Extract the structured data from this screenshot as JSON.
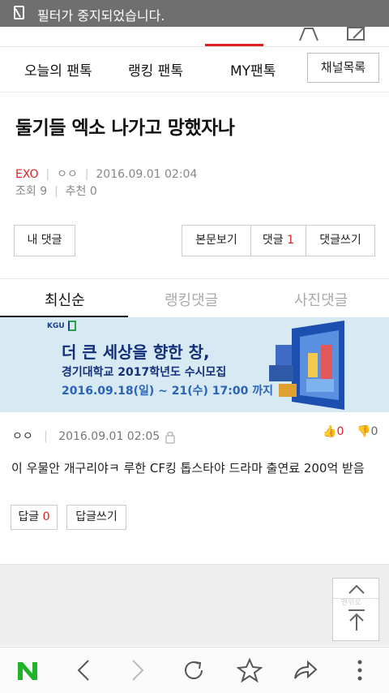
{
  "toast": {
    "text": "필터가 중지되었습니다."
  },
  "tabs": {
    "items": [
      "오늘의 팬톡",
      "랭킹 팬톡",
      "MY팬톡"
    ],
    "channel_button": "채널목록"
  },
  "post": {
    "title": "둘기들 엑소 나가고 망했자나",
    "category": "EXO",
    "author": "ㅇㅇ",
    "datetime": "2016.09.01 02:04",
    "views": "조회 9",
    "likes": "추천 0"
  },
  "buttons": {
    "my_comment": "내 댓글",
    "view_body": "본문보기",
    "comments_label": "댓글",
    "comments_count": "1",
    "write_comment": "댓글쓰기"
  },
  "sort_tabs": {
    "latest": "최신순",
    "ranking": "랭킹댓글",
    "photo": "사진댓글"
  },
  "ad": {
    "logo": "KGU",
    "headline": "더 큰 세상을 향한 창,",
    "subline": "경기대학교 2017학년도 수시모집",
    "dates": "2016.09.18(일) ~ 21(수) 17:00 까지"
  },
  "comment": {
    "author": "ㅇㅇ",
    "datetime": "2016.09.01 02:05",
    "up_count": "0",
    "down_count": "0",
    "text": "이 우물안 개구리야ㅋ 루한 CF킹 톱스타야 드라마 출연료 200억 받음",
    "reply_label": "답글",
    "reply_count": "0",
    "write_reply": "답글쓰기"
  },
  "float": {
    "label": "맨위로"
  },
  "colors": {
    "accent": "#e02020",
    "brand_green": "#1fb32a"
  }
}
